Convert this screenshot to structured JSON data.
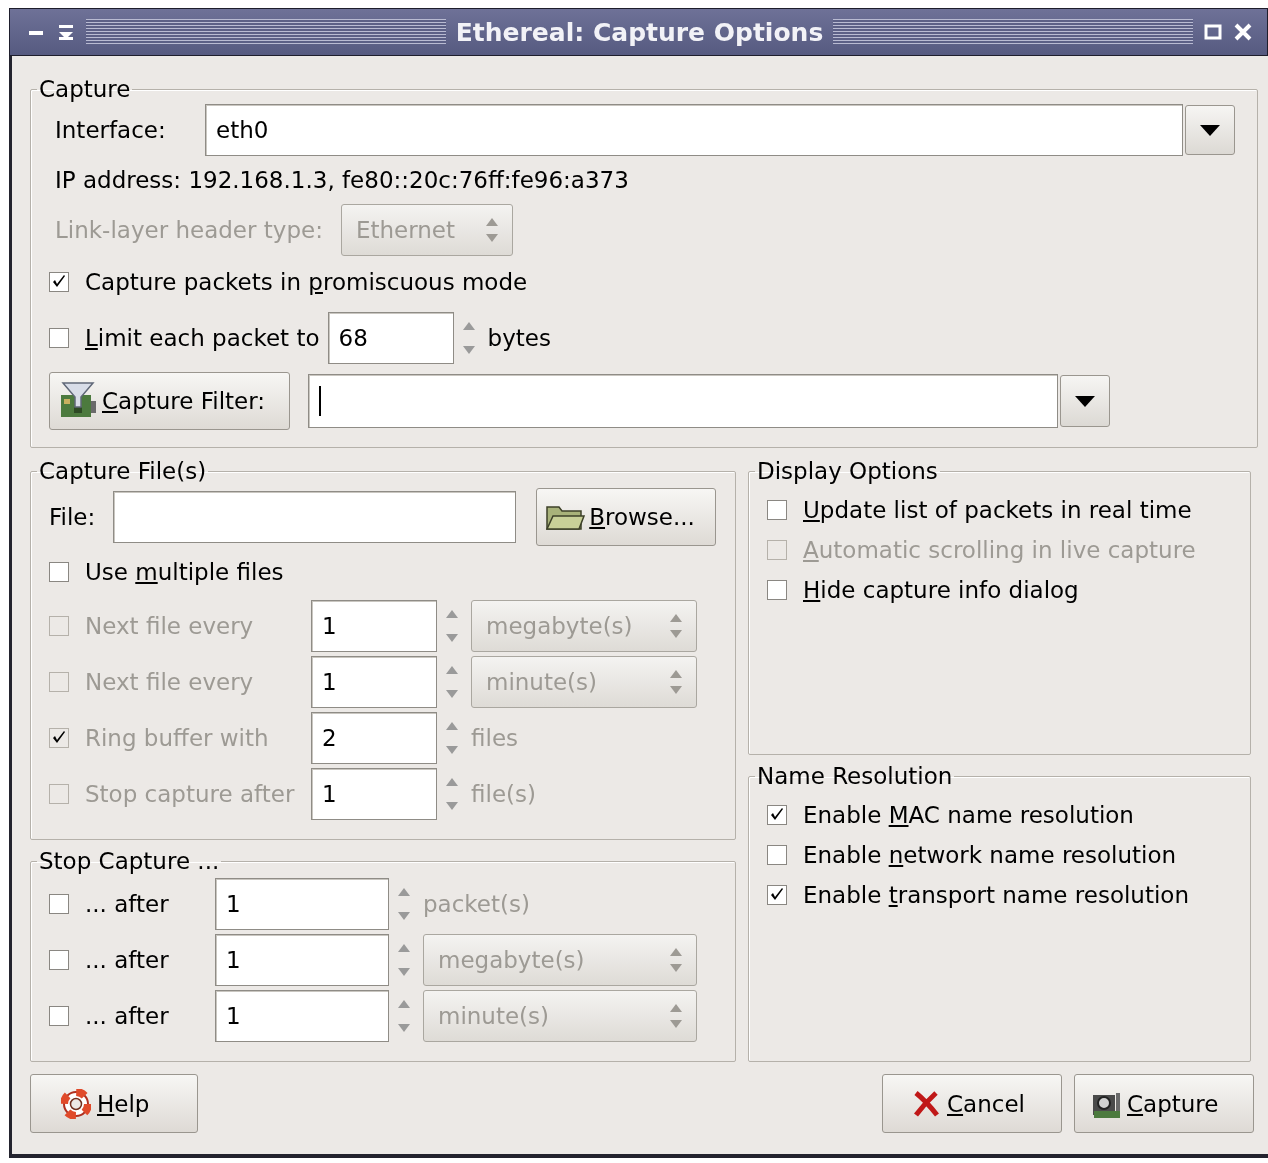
{
  "window": {
    "title": "Ethereal: Capture Options"
  },
  "capture": {
    "title": "Capture",
    "interface": {
      "label": "Interface:",
      "value": "eth0"
    },
    "ip_address": "IP address: 192.168.1.3, fe80::20c:76ff:fe96:a373",
    "link_layer": {
      "label": "Link-layer header type:",
      "value": "Ethernet",
      "disabled": true
    },
    "promiscuous": {
      "label": {
        "before": "Capture packets in ",
        "key": "p",
        "after": "romiscuous mode"
      },
      "checked": true
    },
    "limit": {
      "label": {
        "key": "L",
        "after": "imit each packet to"
      },
      "checked": false,
      "value": "68",
      "unit": "bytes"
    },
    "filter": {
      "button": {
        "key": "C",
        "after": "apture Filter:"
      }
    }
  },
  "capture_files": {
    "title": "Capture File(s)",
    "file_label": "File:",
    "browse": {
      "key": "B",
      "after": "rowse..."
    },
    "multiple": {
      "label": {
        "before": "Use ",
        "key": "m",
        "after": "ultiple files"
      },
      "checked": false
    },
    "rows": [
      {
        "kind": "select",
        "label": "Next file every",
        "checked": false,
        "disabled": true,
        "value": "1",
        "unit": "megabyte(s)"
      },
      {
        "kind": "select",
        "label": "Next file every",
        "checked": false,
        "disabled": true,
        "value": "1",
        "unit": "minute(s)"
      },
      {
        "kind": "text",
        "label": "Ring buffer with",
        "checked": true,
        "disabled": true,
        "value": "2",
        "unit": "files"
      },
      {
        "kind": "text",
        "label": "Stop capture after",
        "checked": false,
        "disabled": true,
        "value": "1",
        "unit": "file(s)"
      }
    ]
  },
  "stop_capture": {
    "title": "Stop Capture ...",
    "rows": [
      {
        "kind": "text",
        "label": "... after",
        "checked": false,
        "disabled": false,
        "value": "1",
        "unit": "packet(s)"
      },
      {
        "kind": "select",
        "label": "... after",
        "checked": false,
        "disabled": false,
        "value": "1",
        "unit": "megabyte(s)"
      },
      {
        "kind": "select",
        "label": "... after",
        "checked": false,
        "disabled": false,
        "value": "1",
        "unit": "minute(s)"
      }
    ]
  },
  "display_options": {
    "title": "Display Options",
    "items": [
      {
        "label": {
          "key": "U",
          "after": "pdate list of packets in real time"
        },
        "checked": false,
        "disabled": false
      },
      {
        "label": {
          "key": "A",
          "after": "utomatic scrolling in live capture"
        },
        "checked": false,
        "disabled": true
      },
      {
        "label": {
          "key": "H",
          "after": "ide capture info dialog"
        },
        "checked": false,
        "disabled": false
      }
    ]
  },
  "name_resolution": {
    "title": "Name Resolution",
    "items": [
      {
        "label": {
          "before": "Enable ",
          "key": "M",
          "after": "AC name resolution"
        },
        "checked": true,
        "disabled": false
      },
      {
        "label": {
          "before": "Enable ",
          "key": "n",
          "after": "etwork name resolution"
        },
        "checked": false,
        "disabled": false
      },
      {
        "label": {
          "before": "Enable ",
          "key": "t",
          "after": "ransport name resolution"
        },
        "checked": true,
        "disabled": false
      }
    ]
  },
  "buttons": [
    {
      "kind": "help",
      "label": {
        "key": "H",
        "after": "elp"
      }
    },
    {
      "kind": "cancel",
      "label": {
        "key": "C",
        "after": "ancel"
      }
    },
    {
      "kind": "capture",
      "label": {
        "key": "C",
        "after": "apture"
      }
    }
  ]
}
